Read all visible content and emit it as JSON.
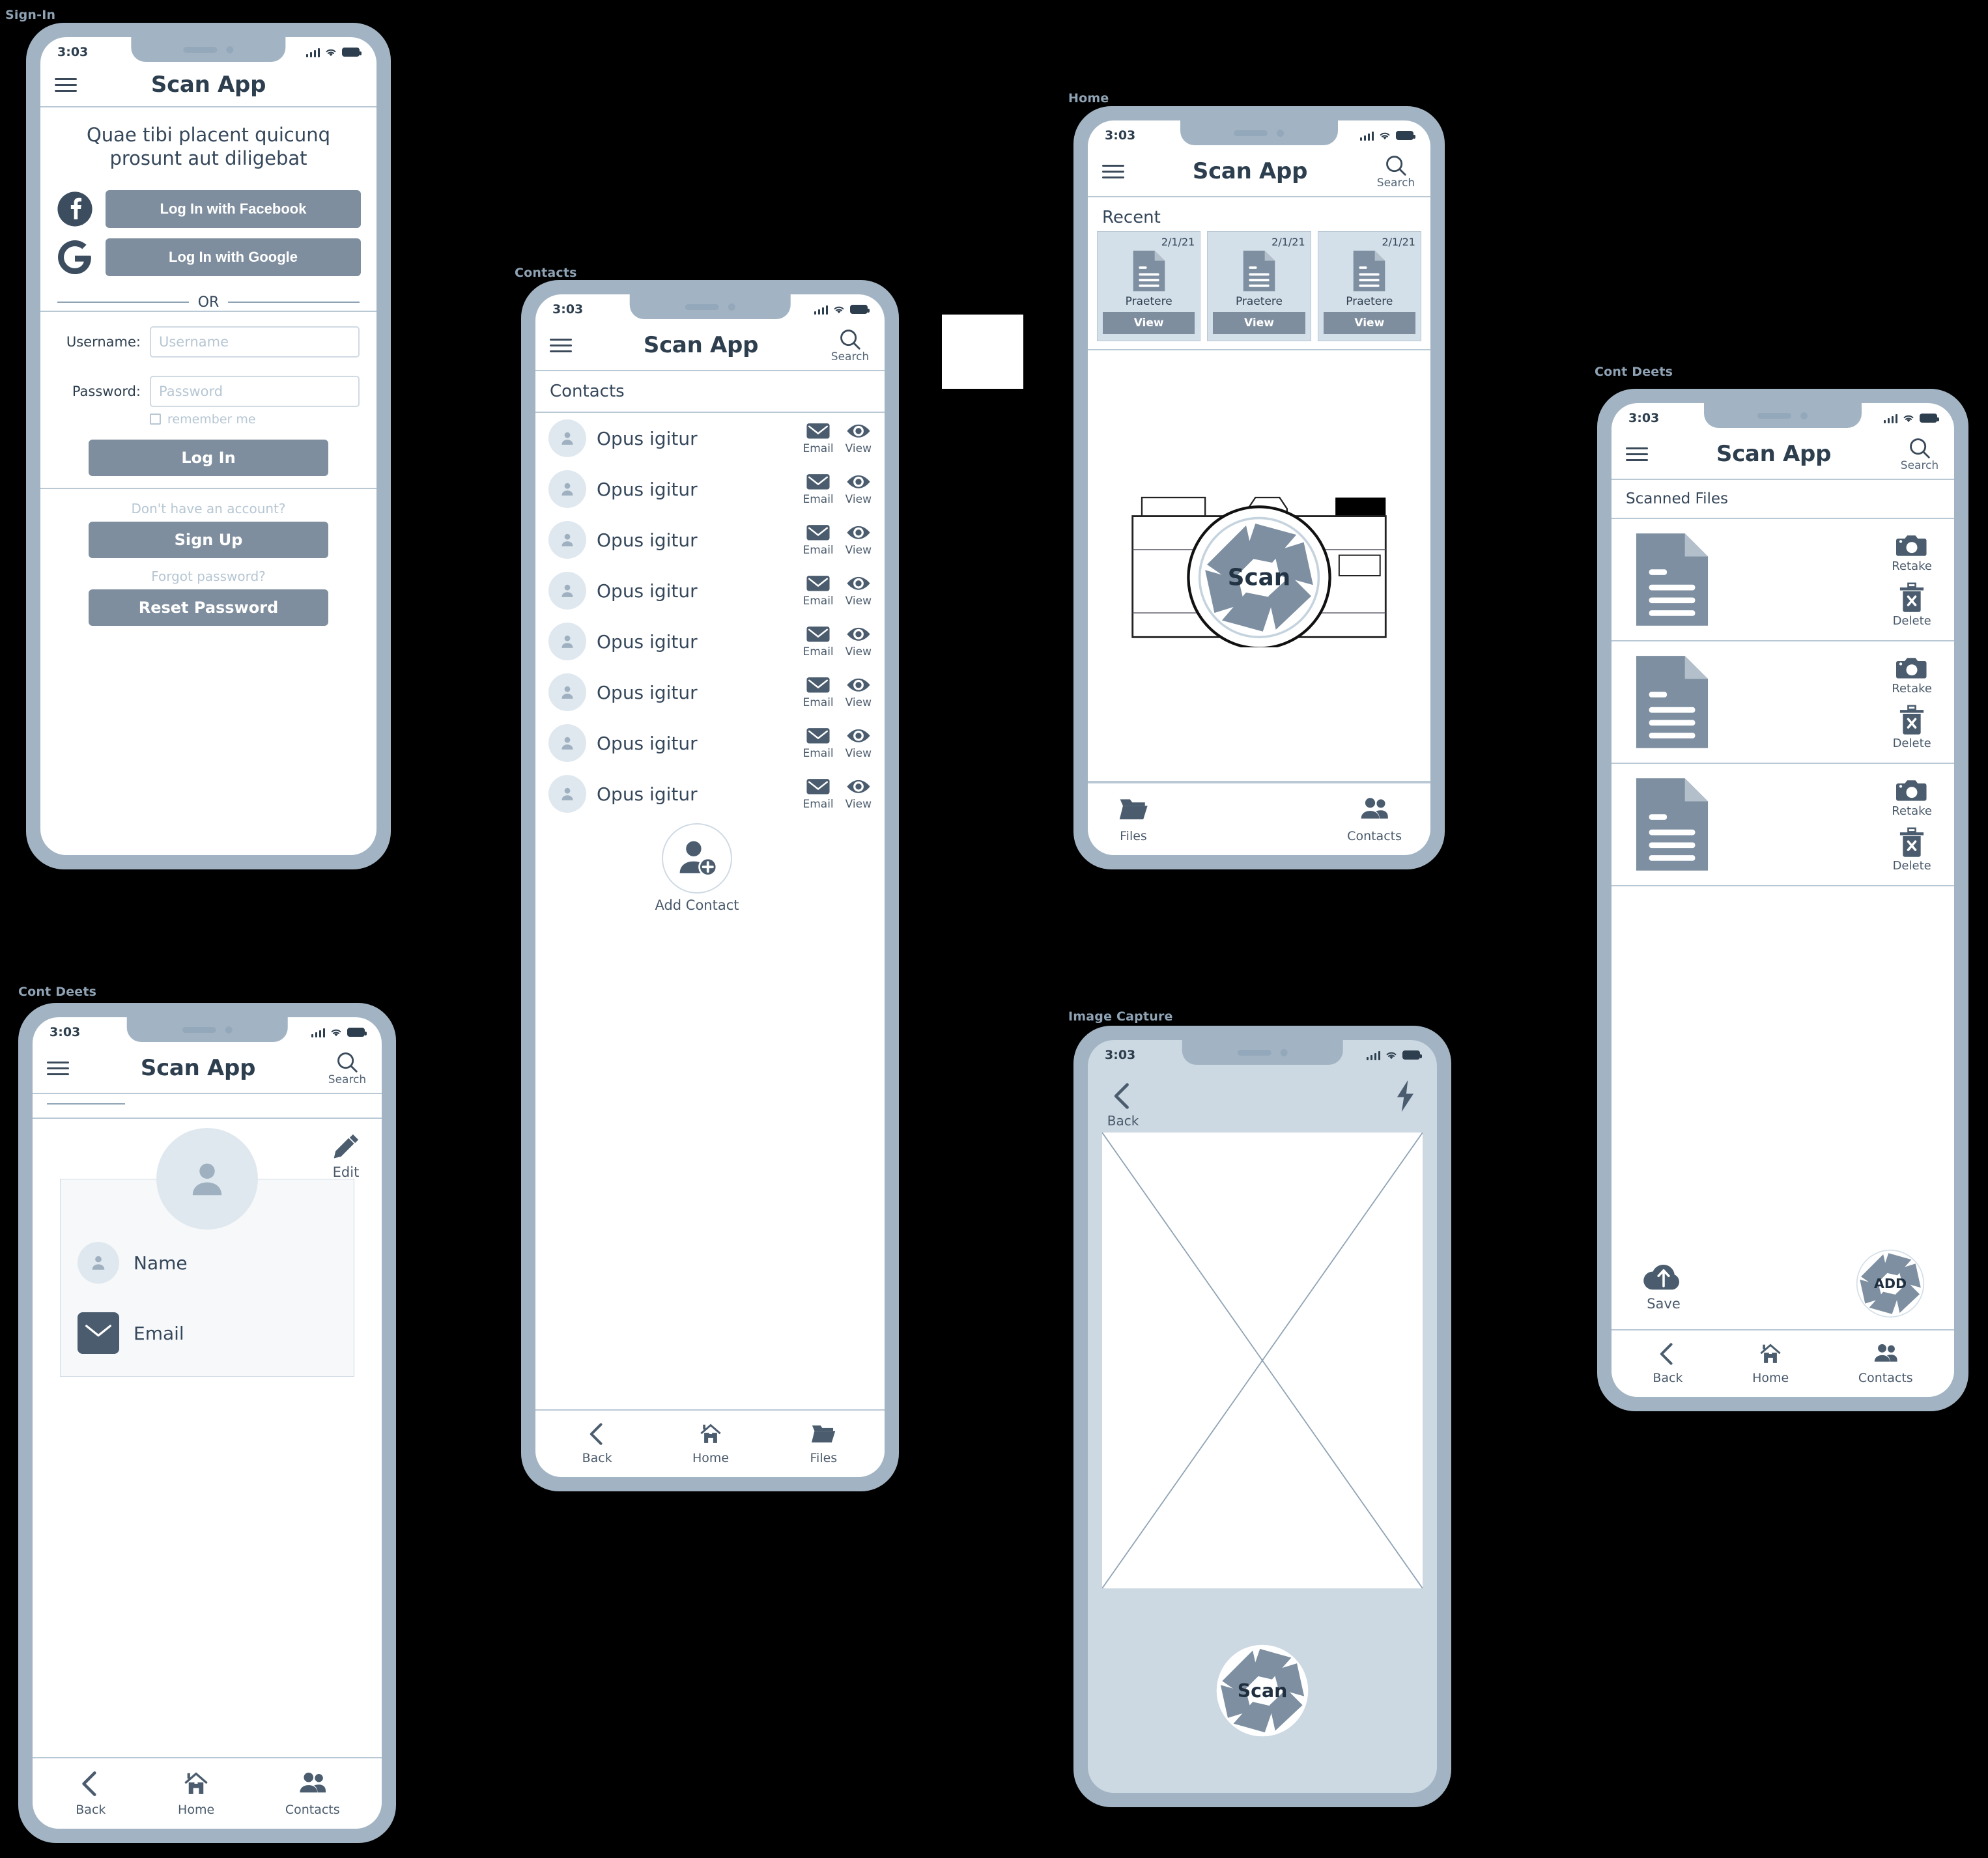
{
  "common": {
    "app_title": "Scan App",
    "status_time": "3:03",
    "search_label": "Search",
    "nav": {
      "back": "Back",
      "home": "Home",
      "files": "Files",
      "contacts": "Contacts"
    },
    "icons": {
      "menu": "hamburger-menu-icon",
      "search": "search-icon",
      "signal": "cellular-signal-icon",
      "wifi": "wifi-icon",
      "battery": "battery-icon"
    }
  },
  "colors": {
    "phone_body": "#a2b4c3",
    "button_fill": "#7e8e9e",
    "icon_dark": "#4a5c6e",
    "icon_mid": "#7d8fa1",
    "avatar_bg": "#e0e8ef",
    "divider": "#b9c8d5",
    "text_dark": "#2d3e4e",
    "text_muted": "#b6c6d3",
    "screen_tint": "#ccd8e2"
  },
  "frames": [
    {
      "id": "signin",
      "label": "Sign-In"
    },
    {
      "id": "contacts",
      "label": "Contacts"
    },
    {
      "id": "home",
      "label": "Home"
    },
    {
      "id": "files",
      "label": "Cont Deets"
    },
    {
      "id": "contdeets",
      "label": "Cont Deets"
    },
    {
      "id": "capture",
      "label": "Image Capture"
    }
  ],
  "signin": {
    "tagline": "Quae tibi placent quicunq prosunt aut diligebat",
    "facebook_button": "Log In with Facebook",
    "google_button": "Log In with Google",
    "facebook_icon": "facebook-logo-icon",
    "google_icon": "google-logo-icon",
    "or_divider": "OR",
    "username_label": "Username:",
    "username_placeholder": "Username",
    "username_value": "",
    "password_label": "Password:",
    "password_placeholder": "Password",
    "password_value": "",
    "remember_label": "remember me",
    "remember_checked": false,
    "login_button": "Log In",
    "no_account_note": "Don't have an account?",
    "signup_button": "Sign Up",
    "forgot_note": "Forgot password?",
    "reset_button": "Reset Password"
  },
  "contacts": {
    "section_title": "Contacts",
    "email_action": "Email",
    "view_action": "View",
    "email_icon": "envelope-icon",
    "view_icon": "eye-icon",
    "avatar_icon": "person-avatar-icon",
    "rows": [
      {
        "name": "Opus igitur"
      },
      {
        "name": "Opus igitur"
      },
      {
        "name": "Opus igitur"
      },
      {
        "name": "Opus igitur"
      },
      {
        "name": "Opus igitur"
      },
      {
        "name": "Opus igitur"
      },
      {
        "name": "Opus igitur"
      },
      {
        "name": "Opus igitur"
      }
    ],
    "add_contact_label": "Add Contact",
    "add_contact_icon": "person-add-icon"
  },
  "home": {
    "section_title": "Recent",
    "recent": [
      {
        "date": "2/1/21",
        "name": "Praetere",
        "button": "View"
      },
      {
        "date": "2/1/21",
        "name": "Praetere",
        "button": "View"
      },
      {
        "date": "2/1/21",
        "name": "Praetere",
        "button": "View"
      }
    ],
    "document_icon": "document-file-icon",
    "camera_icon": "camera-illustration-icon",
    "scan_label": "Scan",
    "shutter_icon": "camera-shutter-icon",
    "files_icon": "folder-icon",
    "contacts_icon": "people-group-icon"
  },
  "files": {
    "section_title": "Scanned Files",
    "retake_label": "Retake",
    "delete_label": "Delete",
    "retake_icon": "camera-icon",
    "delete_icon": "trash-x-icon",
    "document_icon": "document-file-icon",
    "rows": [
      {
        "retake": "Retake",
        "delete": "Delete"
      },
      {
        "retake": "Retake",
        "delete": "Delete"
      },
      {
        "retake": "Retake",
        "delete": "Delete"
      }
    ],
    "save_label": "Save",
    "save_icon": "cloud-upload-icon",
    "add_label": "ADD",
    "add_icon": "camera-shutter-icon"
  },
  "contact_detail": {
    "edit_label": "Edit",
    "edit_icon": "pencil-edit-icon",
    "avatar_icon": "person-avatar-icon",
    "name_label": "Name",
    "name_icon": "person-avatar-icon",
    "email_label": "Email",
    "email_icon": "envelope-icon"
  },
  "capture": {
    "back_label": "Back",
    "back_icon": "chevron-left-icon",
    "flash_icon": "lightning-flash-icon",
    "viewfinder_icon": "image-placeholder-crossed-box",
    "scan_label": "Scan",
    "shutter_icon": "camera-shutter-icon"
  }
}
